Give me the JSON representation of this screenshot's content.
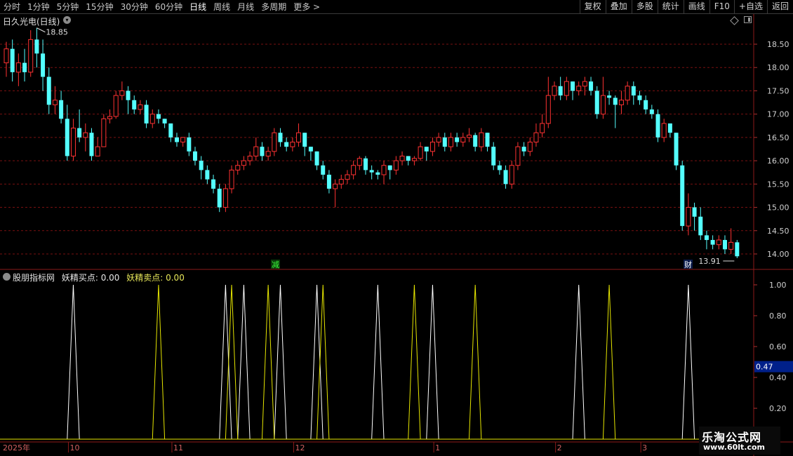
{
  "toolbar": {
    "periods": [
      "分时",
      "1分钟",
      "5分钟",
      "15分钟",
      "30分钟",
      "60分钟",
      "日线",
      "周线",
      "月线",
      "多周期",
      "更多 >"
    ],
    "active_period": "日线",
    "tools": [
      "复权",
      "叠加",
      "多股",
      "统计",
      "画线",
      "F10",
      "+自选",
      "返回"
    ]
  },
  "stock": {
    "title": "日久光电(日线)"
  },
  "indicator": {
    "name": "股朋指标网",
    "value1_text": "妖精买点: 0.00",
    "value2_text": "妖精卖点: 0.00",
    "cursor_value": "0.47"
  },
  "markers": {
    "left": "减",
    "right": "财"
  },
  "watermark": {
    "line1": "乐淘公式网",
    "line2": "www.60lt.com"
  },
  "colors": {
    "up": "#ff3232",
    "down": "#54ffff",
    "buy": "#ffffff",
    "sell": "#e6e600",
    "grid": "#7a1010",
    "axis": "#8b1a1a"
  },
  "chart_data": [
    {
      "type": "candlestick",
      "title": "",
      "y_ticks": [
        18.5,
        18.0,
        17.5,
        17.0,
        16.5,
        16.0,
        15.5,
        15.0,
        14.5,
        14.0
      ],
      "ylim": [
        13.8,
        18.9
      ],
      "annotations": {
        "high_label": "18.85",
        "low_label": "13.91"
      },
      "candles": [
        [
          18.1,
          18.4,
          18.55,
          17.8
        ],
        [
          18.4,
          17.9,
          18.6,
          17.7
        ],
        [
          17.9,
          18.1,
          18.3,
          17.6
        ],
        [
          18.1,
          17.9,
          18.4,
          17.7
        ],
        [
          17.9,
          18.6,
          18.8,
          17.8
        ],
        [
          18.6,
          18.3,
          18.85,
          18.0
        ],
        [
          18.3,
          17.8,
          18.6,
          17.5
        ],
        [
          17.8,
          17.2,
          18.0,
          17.0
        ],
        [
          17.2,
          17.3,
          17.6,
          17.0
        ],
        [
          17.3,
          16.9,
          17.5,
          16.8
        ],
        [
          16.9,
          16.1,
          17.2,
          16.0
        ],
        [
          16.1,
          16.7,
          16.9,
          16.0
        ],
        [
          16.7,
          16.5,
          17.1,
          16.4
        ],
        [
          16.5,
          16.6,
          16.8,
          16.2
        ],
        [
          16.6,
          16.1,
          16.7,
          16.0
        ],
        [
          16.1,
          16.3,
          16.5,
          16.1
        ],
        [
          16.3,
          16.9,
          17.0,
          16.8
        ],
        [
          16.9,
          16.95,
          17.1,
          16.8
        ],
        [
          16.95,
          17.4,
          17.5,
          16.9
        ],
        [
          17.4,
          17.5,
          17.7,
          17.3
        ],
        [
          17.5,
          17.3,
          17.6,
          17.0
        ],
        [
          17.3,
          17.1,
          17.4,
          17.0
        ],
        [
          17.1,
          17.2,
          17.3,
          17.0
        ],
        [
          17.2,
          16.8,
          17.3,
          16.7
        ],
        [
          16.8,
          17.0,
          17.1,
          16.7
        ],
        [
          17.0,
          16.9,
          17.1,
          16.8
        ],
        [
          16.9,
          16.8,
          16.9,
          16.7
        ],
        [
          16.8,
          16.5,
          16.8,
          16.4
        ],
        [
          16.5,
          16.4,
          16.6,
          16.3
        ],
        [
          16.4,
          16.5,
          16.5,
          16.3
        ],
        [
          16.5,
          16.2,
          16.6,
          16.1
        ],
        [
          16.2,
          16.0,
          16.3,
          15.9
        ],
        [
          16.0,
          15.8,
          16.1,
          15.6
        ],
        [
          15.8,
          15.6,
          15.9,
          15.5
        ],
        [
          15.6,
          15.4,
          15.7,
          15.3
        ],
        [
          15.4,
          15.0,
          15.5,
          14.9
        ],
        [
          15.0,
          15.4,
          15.5,
          14.9
        ],
        [
          15.4,
          15.8,
          15.9,
          15.3
        ],
        [
          15.8,
          15.9,
          16.0,
          15.7
        ],
        [
          15.9,
          16.0,
          16.1,
          15.8
        ],
        [
          16.0,
          16.1,
          16.2,
          15.9
        ],
        [
          16.1,
          16.3,
          16.5,
          16.0
        ],
        [
          16.3,
          16.1,
          16.4,
          16.0
        ],
        [
          16.1,
          16.2,
          16.3,
          16.0
        ],
        [
          16.2,
          16.6,
          16.7,
          16.1
        ],
        [
          16.6,
          16.4,
          16.7,
          16.3
        ],
        [
          16.4,
          16.3,
          16.5,
          16.2
        ],
        [
          16.3,
          16.4,
          16.5,
          16.2
        ],
        [
          16.4,
          16.6,
          16.8,
          16.3
        ],
        [
          16.6,
          16.3,
          16.6,
          16.1
        ],
        [
          16.3,
          16.2,
          16.3,
          16.0
        ],
        [
          16.2,
          15.9,
          16.2,
          15.8
        ],
        [
          15.9,
          15.7,
          16.0,
          15.6
        ],
        [
          15.7,
          15.4,
          15.8,
          15.3
        ],
        [
          15.4,
          15.5,
          15.6,
          15.0
        ],
        [
          15.5,
          15.6,
          15.7,
          15.4
        ],
        [
          15.6,
          15.7,
          15.8,
          15.5
        ],
        [
          15.7,
          15.9,
          16.0,
          15.6
        ],
        [
          15.9,
          16.05,
          16.1,
          15.8
        ],
        [
          16.05,
          15.8,
          16.1,
          15.7
        ],
        [
          15.8,
          15.75,
          15.9,
          15.6
        ],
        [
          15.75,
          15.7,
          15.8,
          15.6
        ],
        [
          15.7,
          15.9,
          16.0,
          15.5
        ],
        [
          15.9,
          15.8,
          15.9,
          15.6
        ],
        [
          15.8,
          16.0,
          16.1,
          15.7
        ],
        [
          16.0,
          16.1,
          16.2,
          15.9
        ],
        [
          16.1,
          16.0,
          16.1,
          15.9
        ],
        [
          16.0,
          16.05,
          16.1,
          15.9
        ],
        [
          16.05,
          16.3,
          16.4,
          16.0
        ],
        [
          16.3,
          16.2,
          16.3,
          16.0
        ],
        [
          16.2,
          16.4,
          16.5,
          16.1
        ],
        [
          16.4,
          16.5,
          16.6,
          16.3
        ],
        [
          16.5,
          16.3,
          16.6,
          16.2
        ],
        [
          16.3,
          16.5,
          16.6,
          16.2
        ],
        [
          16.5,
          16.4,
          16.6,
          16.3
        ],
        [
          16.4,
          16.5,
          16.6,
          16.3
        ],
        [
          16.5,
          16.55,
          16.7,
          16.4
        ],
        [
          16.55,
          16.3,
          16.6,
          16.2
        ],
        [
          16.3,
          16.6,
          16.7,
          16.2
        ],
        [
          16.6,
          16.3,
          16.6,
          16.2
        ],
        [
          16.3,
          15.9,
          16.4,
          15.8
        ],
        [
          15.9,
          15.8,
          16.0,
          15.7
        ],
        [
          15.8,
          15.5,
          15.9,
          15.4
        ],
        [
          15.5,
          15.9,
          16.0,
          15.4
        ],
        [
          15.9,
          16.3,
          16.4,
          15.8
        ],
        [
          16.3,
          16.2,
          16.4,
          16.1
        ],
        [
          16.2,
          16.4,
          16.5,
          16.1
        ],
        [
          16.4,
          16.6,
          16.8,
          16.3
        ],
        [
          16.6,
          16.8,
          17.0,
          16.5
        ],
        [
          16.8,
          17.4,
          17.8,
          16.7
        ],
        [
          17.4,
          17.6,
          17.7,
          17.3
        ],
        [
          17.6,
          17.4,
          17.8,
          17.3
        ],
        [
          17.4,
          17.7,
          17.8,
          17.3
        ],
        [
          17.7,
          17.5,
          17.7,
          17.3
        ],
        [
          17.5,
          17.6,
          17.7,
          17.4
        ],
        [
          17.6,
          17.7,
          17.8,
          17.4
        ],
        [
          17.7,
          17.5,
          17.8,
          17.4
        ],
        [
          17.5,
          17.0,
          17.6,
          16.9
        ],
        [
          17.0,
          17.4,
          17.8,
          16.9
        ],
        [
          17.4,
          17.35,
          17.5,
          17.2
        ],
        [
          17.35,
          17.2,
          17.4,
          16.7
        ],
        [
          17.2,
          17.3,
          17.5,
          17.0
        ],
        [
          17.3,
          17.6,
          17.7,
          17.2
        ],
        [
          17.6,
          17.4,
          17.7,
          17.2
        ],
        [
          17.4,
          17.3,
          17.5,
          17.2
        ],
        [
          17.3,
          17.1,
          17.4,
          17.0
        ],
        [
          17.1,
          17.0,
          17.2,
          16.9
        ],
        [
          17.0,
          16.5,
          17.1,
          16.4
        ],
        [
          16.5,
          16.8,
          16.9,
          16.4
        ],
        [
          16.8,
          16.6,
          16.8,
          16.5
        ],
        [
          16.6,
          15.9,
          16.6,
          15.8
        ],
        [
          15.9,
          14.6,
          16.0,
          14.5
        ],
        [
          14.6,
          15.0,
          15.3,
          14.4
        ],
        [
          15.0,
          14.8,
          15.1,
          14.5
        ],
        [
          14.8,
          14.4,
          15.0,
          14.3
        ],
        [
          14.4,
          14.3,
          14.5,
          14.1
        ],
        [
          14.3,
          14.2,
          14.4,
          14.1
        ],
        [
          14.2,
          14.3,
          14.4,
          14.1
        ],
        [
          14.3,
          14.1,
          14.4,
          14.0
        ],
        [
          14.1,
          14.25,
          14.55,
          14.0
        ],
        [
          14.25,
          13.95,
          14.3,
          13.91
        ]
      ]
    },
    {
      "type": "line",
      "title": "",
      "y_ticks": [
        1.0,
        0.8,
        0.6,
        0.4,
        0.2
      ],
      "ylim": [
        0,
        1.0
      ],
      "series": [
        {
          "name": "妖精买点",
          "x": [
            11,
            36,
            39,
            45,
            51,
            61,
            70,
            94,
            112
          ],
          "values": [
            1,
            1,
            1,
            1,
            1,
            1,
            1,
            1,
            1
          ]
        },
        {
          "name": "妖精卖点",
          "x": [
            25,
            37,
            43,
            52,
            67,
            77,
            99
          ],
          "values": [
            1,
            1,
            1,
            1,
            1,
            1,
            1
          ]
        }
      ],
      "x_labels": [
        {
          "i": 0,
          "text": "2025年"
        },
        {
          "i": 11,
          "text": "10"
        },
        {
          "i": 28,
          "text": "11"
        },
        {
          "i": 48,
          "text": "12"
        },
        {
          "i": 71,
          "text": "1"
        },
        {
          "i": 91,
          "text": "2"
        },
        {
          "i": 105,
          "text": "3"
        }
      ]
    }
  ]
}
